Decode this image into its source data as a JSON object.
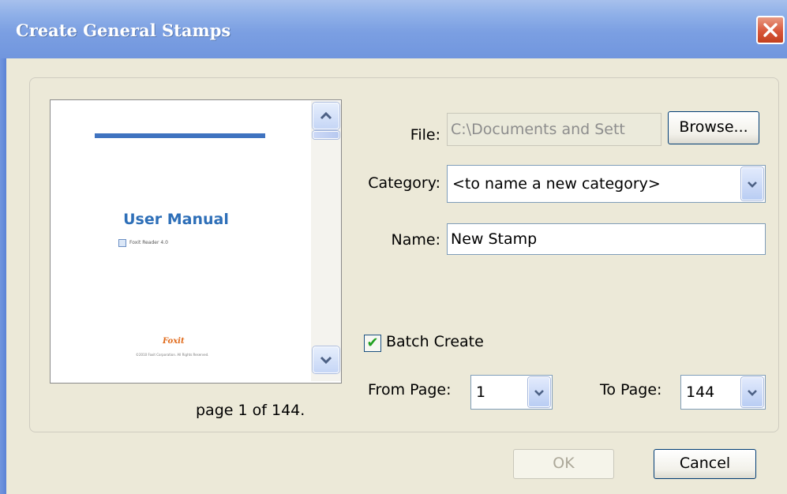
{
  "window": {
    "title": "Create General Stamps",
    "close_icon": "close-icon"
  },
  "preview": {
    "page_title": "User Manual",
    "page_subtitle": "Foxit Reader 4.0",
    "page_logo": "Foxit",
    "page_footer": "©2010 Foxit Corporation. All Rights Reserved.",
    "page_info": "page 1 of  144.",
    "scroll_up_icon": "chevron-up-icon",
    "scroll_down_icon": "chevron-down-icon"
  },
  "form": {
    "file_label": "File:",
    "file_value": "C:\\Documents and Sett",
    "browse_label": "Browse...",
    "category_label": "Category:",
    "category_value": "<to name a new category>",
    "name_label": "Name:",
    "name_value": "New Stamp",
    "batch_label": "Batch Create",
    "batch_checked": true,
    "from_label": "From Page:",
    "from_value": "1",
    "to_label": "To Page:",
    "to_value": "144"
  },
  "footer": {
    "ok_label": "OK",
    "cancel_label": "Cancel"
  }
}
